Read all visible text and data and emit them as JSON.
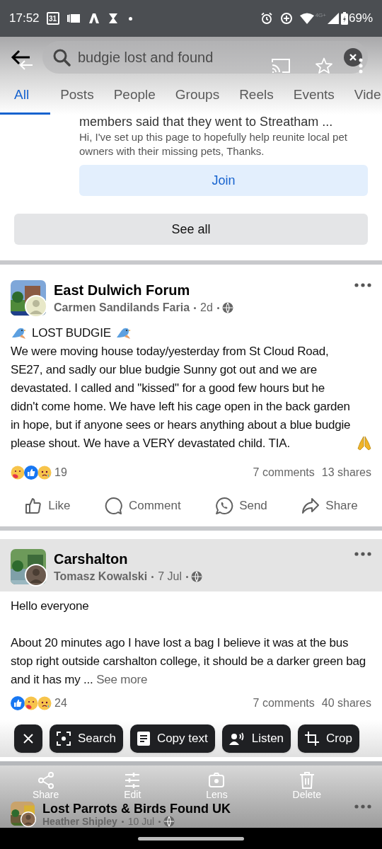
{
  "status_bar": {
    "time": "17:52",
    "calendar_day": "31",
    "network": "4G+",
    "battery": "69%"
  },
  "search": {
    "value": "budgie lost and found"
  },
  "tabs": [
    {
      "label": "All",
      "selected": true
    },
    {
      "label": "Posts",
      "selected": false
    },
    {
      "label": "People",
      "selected": false
    },
    {
      "label": "Groups",
      "selected": false
    },
    {
      "label": "Reels",
      "selected": false
    },
    {
      "label": "Events",
      "selected": false
    },
    {
      "label": "Vide",
      "selected": false
    }
  ],
  "group_card": {
    "members_note": "members said that they went to Streatham ...",
    "description": "Hi, I've set up this page to hopefully help reunite local pet owners with their missing pets, Thanks.",
    "join_button": "Join",
    "see_all_button": "See all"
  },
  "posts": [
    {
      "group": "East Dulwich Forum",
      "author": "Carmen Sandilands Faria",
      "time": "2d",
      "headline": "LOST BUDGIE",
      "body": "We were moving house today/yesterday from St Cloud Road, SE27, and sadly our blue budgie Sunny got out and we are devastated. I called and \"kissed\" for a good few hours but he didn't come home. We have left his cage open in the back garden in hope,  but if anyone sees or hears anything about a blue budgie please shout. We have a VERY devastated child. TIA.",
      "reactions": [
        {
          "kind": "care"
        },
        {
          "kind": "like"
        },
        {
          "kind": "sad"
        }
      ],
      "reaction_count": "19",
      "comments": "7 comments",
      "shares": "13 shares",
      "actions": [
        {
          "kind": "like",
          "label": "Like"
        },
        {
          "kind": "comment",
          "label": "Comment"
        },
        {
          "kind": "send",
          "label": "Send"
        },
        {
          "kind": "share",
          "label": "Share"
        }
      ]
    },
    {
      "group": "Carshalton",
      "author": "Tomasz Kowalski",
      "time": "7 Jul",
      "highlighted": true,
      "body": "Hello everyone\n\nAbout 20 minutes ago I have lost a bag I believe it was at the bus stop right outside carshalton college, it should be a darker green bag and it has my ...",
      "see_more": "See more",
      "reactions": [
        {
          "kind": "like"
        },
        {
          "kind": "care"
        },
        {
          "kind": "sad"
        }
      ],
      "reaction_count": "24",
      "comments": "7 comments",
      "shares": "40 shares"
    },
    {
      "group": "Lost Parrots & Birds Found UK",
      "author": "Heather Shipley",
      "time": "10 Jul"
    }
  ],
  "edit_chips": [
    {
      "kind": "close"
    },
    {
      "kind": "search",
      "label": "Search"
    },
    {
      "kind": "copy",
      "label": "Copy text"
    },
    {
      "kind": "listen",
      "label": "Listen"
    },
    {
      "kind": "crop",
      "label": "Crop"
    }
  ],
  "screenshot_actions": [
    {
      "kind": "share",
      "label": "Share"
    },
    {
      "kind": "edit",
      "label": "Edit"
    },
    {
      "kind": "lens",
      "label": "Lens"
    },
    {
      "kind": "delete",
      "label": "Delete"
    }
  ]
}
